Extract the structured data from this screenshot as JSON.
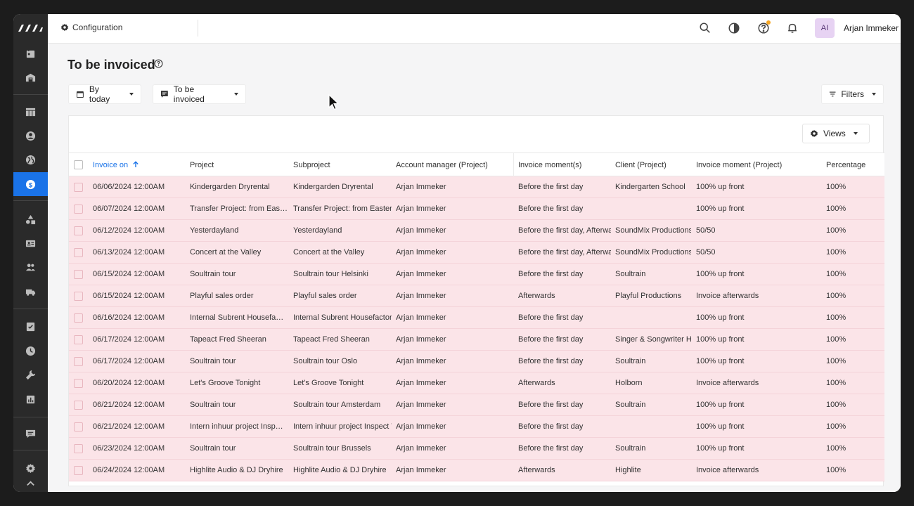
{
  "app": {
    "breadcrumb": "Configuration",
    "user_initials": "AI",
    "user_name": "Arjan Immeker"
  },
  "page": {
    "title": "To be invoiced"
  },
  "filters": {
    "date_label": "By today",
    "status_label": "To be invoiced",
    "filters_label": "Filters",
    "views_label": "Views"
  },
  "table": {
    "columns": [
      "Invoice on",
      "Project",
      "Subproject",
      "Account manager (Project)",
      "Invoice moment(s)",
      "Client (Project)",
      "Invoice moment (Project)",
      "Percentage"
    ],
    "rows": [
      {
        "invoice_on": "06/06/2024 12:00AM",
        "project": "Kindergarden Dryrental",
        "subproject": "Kindergarden Dryrental",
        "account_manager": "Arjan Immeker",
        "moments": "Before the first day",
        "client": "Kindergarten School",
        "moment_project": "100% up front",
        "percentage": "100%"
      },
      {
        "invoice_on": "06/07/2024 12:00AM",
        "project": "Transfer Project: from Eas…",
        "subproject": "Transfer Project: from Eastern",
        "account_manager": "Arjan Immeker",
        "moments": "Before the first day",
        "client": "",
        "moment_project": "100% up front",
        "percentage": "100%"
      },
      {
        "invoice_on": "06/12/2024 12:00AM",
        "project": "Yesterdayland",
        "subproject": "Yesterdayland",
        "account_manager": "Arjan Immeker",
        "moments": "Before the first day, Afterwar",
        "client": "SoundMix Productions",
        "moment_project": "50/50",
        "percentage": "100%"
      },
      {
        "invoice_on": "06/13/2024 12:00AM",
        "project": "Concert at the Valley",
        "subproject": "Concert at the Valley",
        "account_manager": "Arjan Immeker",
        "moments": "Before the first day, Afterwar",
        "client": "SoundMix Productions",
        "moment_project": "50/50",
        "percentage": "100%"
      },
      {
        "invoice_on": "06/15/2024 12:00AM",
        "project": "Soultrain tour",
        "subproject": "Soultrain tour Helsinki",
        "account_manager": "Arjan Immeker",
        "moments": "Before the first day",
        "client": "Soultrain",
        "moment_project": "100% up front",
        "percentage": "100%"
      },
      {
        "invoice_on": "06/15/2024 12:00AM",
        "project": "Playful sales order",
        "subproject": "Playful sales order",
        "account_manager": "Arjan Immeker",
        "moments": "Afterwards",
        "client": "Playful Productions",
        "moment_project": "Invoice afterwards",
        "percentage": "100%"
      },
      {
        "invoice_on": "06/16/2024 12:00AM",
        "project": "Internal Subrent Housefa…",
        "subproject": "Internal Subrent Housefactory",
        "account_manager": "Arjan Immeker",
        "moments": "Before the first day",
        "client": "",
        "moment_project": "100% up front",
        "percentage": "100%"
      },
      {
        "invoice_on": "06/17/2024 12:00AM",
        "project": "Tapeact Fred Sheeran",
        "subproject": "Tapeact Fred Sheeran",
        "account_manager": "Arjan Immeker",
        "moments": "Before the first day",
        "client": "Singer & Songwriter He",
        "moment_project": "100% up front",
        "percentage": "100%"
      },
      {
        "invoice_on": "06/17/2024 12:00AM",
        "project": "Soultrain tour",
        "subproject": "Soultrain tour Oslo",
        "account_manager": "Arjan Immeker",
        "moments": "Before the first day",
        "client": "Soultrain",
        "moment_project": "100% up front",
        "percentage": "100%"
      },
      {
        "invoice_on": "06/20/2024 12:00AM",
        "project": "Let's Groove Tonight",
        "subproject": "Let's Groove Tonight",
        "account_manager": "Arjan Immeker",
        "moments": "Afterwards",
        "client": "Holborn",
        "moment_project": "Invoice afterwards",
        "percentage": "100%"
      },
      {
        "invoice_on": "06/21/2024 12:00AM",
        "project": "Soultrain tour",
        "subproject": "Soultrain tour Amsterdam",
        "account_manager": "Arjan Immeker",
        "moments": "Before the first day",
        "client": "Soultrain",
        "moment_project": "100% up front",
        "percentage": "100%"
      },
      {
        "invoice_on": "06/21/2024 12:00AM",
        "project": "Intern inhuur project Insp…",
        "subproject": "Intern inhuur project Inspect V",
        "account_manager": "Arjan Immeker",
        "moments": "Before the first day",
        "client": "",
        "moment_project": "100% up front",
        "percentage": "100%"
      },
      {
        "invoice_on": "06/23/2024 12:00AM",
        "project": "Soultrain tour",
        "subproject": "Soultrain tour Brussels",
        "account_manager": "Arjan Immeker",
        "moments": "Before the first day",
        "client": "Soultrain",
        "moment_project": "100% up front",
        "percentage": "100%"
      },
      {
        "invoice_on": "06/24/2024 12:00AM",
        "project": "Highlite Audio & DJ Dryhire",
        "subproject": "Highlite Audio & DJ Dryhire",
        "account_manager": "Arjan Immeker",
        "moments": "Afterwards",
        "client": "Highlite",
        "moment_project": "Invoice afterwards",
        "percentage": "100%"
      }
    ]
  },
  "colors": {
    "accent": "#1a73e8",
    "row_highlight": "#fbe4e8",
    "sidebar_bg": "#2a2a2a"
  }
}
